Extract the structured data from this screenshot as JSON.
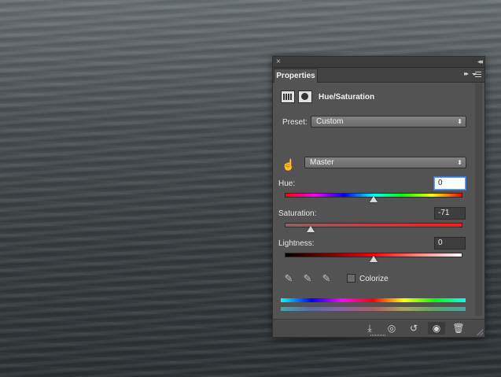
{
  "panel": {
    "title_close": "×",
    "title_collapse": "◂◂",
    "tab_label": "Properties",
    "tab_forward": "▸▸",
    "adjustment_title": "Hue/Saturation"
  },
  "preset": {
    "label": "Preset:",
    "value": "Custom"
  },
  "channel": {
    "value": "Master"
  },
  "hue": {
    "label": "Hue:",
    "value": "0",
    "level_fraction": 0.5
  },
  "saturation": {
    "label": "Saturation:",
    "value": "-71",
    "level_fraction": 0.145
  },
  "lightness": {
    "label": "Lightness:",
    "value": "0",
    "level_fraction": 0.5
  },
  "colorize": {
    "label": "Colorize",
    "checked": false
  },
  "icons": {
    "close": "close-icon",
    "collapse": "collapse-icon",
    "panel_menu": "panel-menu-icon",
    "adjustment": "hue-saturation-icon",
    "mask": "mask-icon",
    "targeted_adjust": "hand-icon",
    "eyedroppers": [
      "eyedropper-icon",
      "eyedropper-plus-icon",
      "eyedropper-minus-icon"
    ],
    "footer": [
      "clip-to-layer-icon",
      "view-previous-icon",
      "reset-icon",
      "visibility-eye-icon",
      "trash-icon"
    ]
  },
  "colors": {
    "panel_bg": "#535353",
    "active_field_border": "#3a78d6"
  }
}
